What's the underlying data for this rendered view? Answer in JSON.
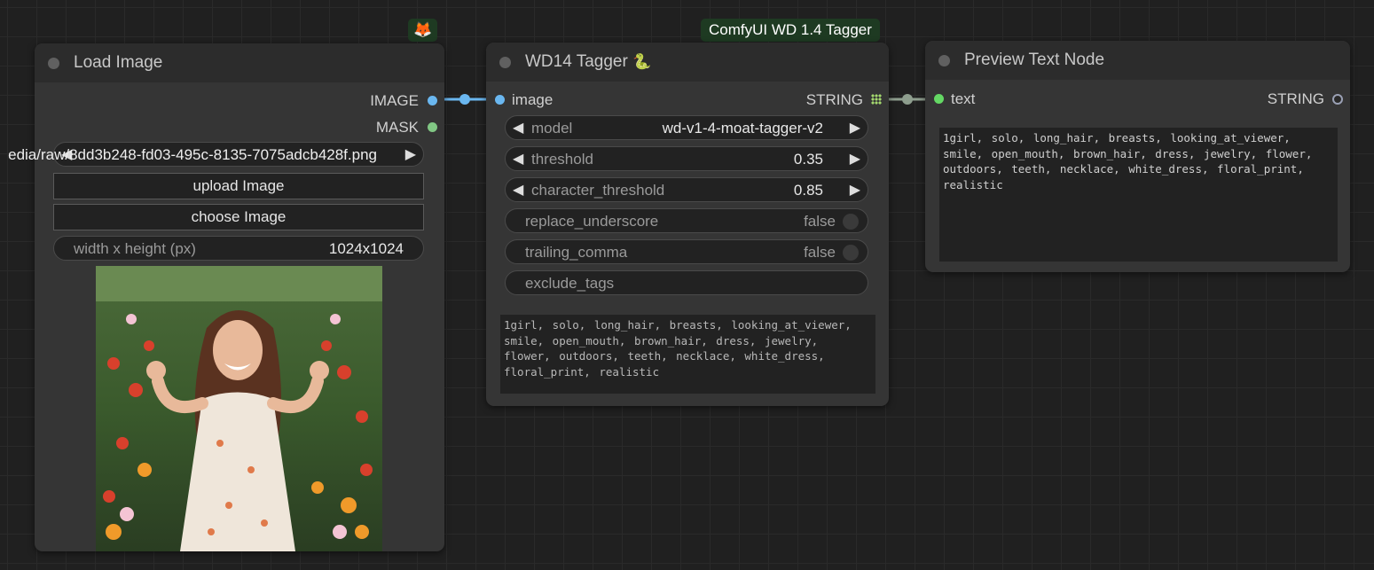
{
  "load_image": {
    "title": "Load Image",
    "outputs": {
      "image": "IMAGE",
      "mask": "MASK"
    },
    "image_widget": {
      "value": "edia/raw/8dd3b248-fd03-495c-8135-7075adcb428f.png"
    },
    "upload_label": "upload Image",
    "choose_label": "choose Image",
    "size_widget": {
      "label": "width x height (px)",
      "value": "1024x1024"
    }
  },
  "badges": {
    "fox": "🦊",
    "wd": "ComfyUI WD 1.4 Tagger"
  },
  "tagger": {
    "title": "WD14 Tagger",
    "title_icon": "🐍",
    "input": "image",
    "output": "STRING",
    "model": {
      "label": "model",
      "value": "wd-v1-4-moat-tagger-v2"
    },
    "threshold": {
      "label": "threshold",
      "value": "0.35"
    },
    "character_threshold": {
      "label": "character_threshold",
      "value": "0.85"
    },
    "replace_underscore": {
      "label": "replace_underscore",
      "value": "false"
    },
    "trailing_comma": {
      "label": "trailing_comma",
      "value": "false"
    },
    "exclude_tags": {
      "label": "exclude_tags"
    },
    "output_text": "1girl, solo, long_hair, breasts, looking_at_viewer, smile, open_mouth, brown_hair, dress, jewelry, flower, outdoors, teeth, necklace, white_dress, floral_print, realistic"
  },
  "preview": {
    "title": "Preview Text Node",
    "input": "text",
    "output": "STRING",
    "text": "1girl, solo, long_hair, breasts, looking_at_viewer, smile, open_mouth, brown_hair, dress, jewelry, flower, outdoors, teeth, necklace, white_dress, floral_print, realistic"
  },
  "colors": {
    "image_port": "#6ab7f0",
    "mask_port": "#81c784",
    "string_port": "#a4d86e",
    "text_port": "#64d864",
    "wire_image": "#6ab7f0",
    "wire_string": "#8e9e8e",
    "badge_bg": "#1e3a22"
  }
}
